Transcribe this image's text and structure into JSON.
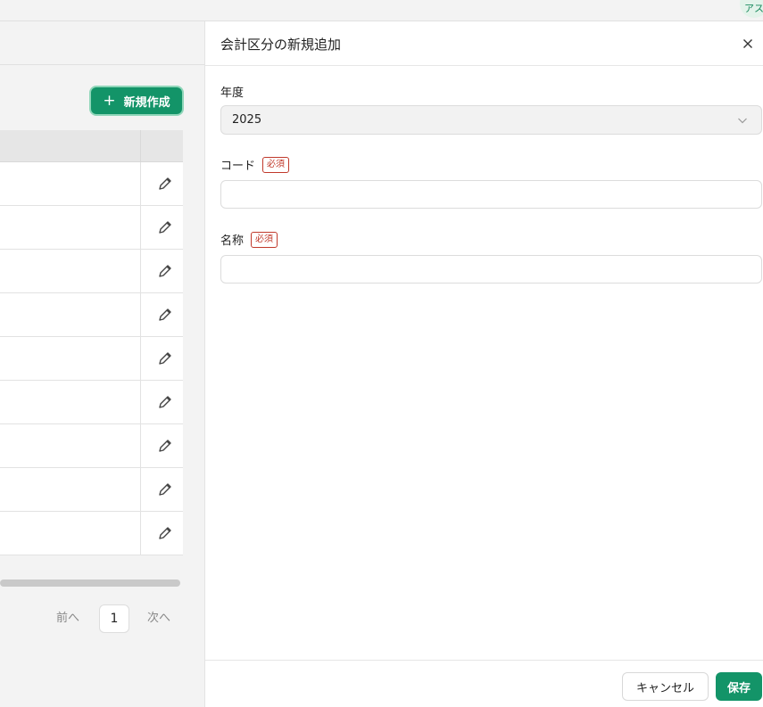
{
  "topbar": {
    "avatar_text": "アス"
  },
  "list": {
    "create_label": "新規作成",
    "rows": 9,
    "pager": {
      "prev_label": "前へ",
      "page": "1",
      "next_label": "次へ"
    }
  },
  "drawer": {
    "title": "会計区分の新規追加",
    "fields": {
      "year": {
        "label": "年度",
        "value": "2025"
      },
      "code": {
        "label": "コード",
        "required_label": "必須",
        "value": "",
        "placeholder": ""
      },
      "name": {
        "label": "名称",
        "required_label": "必須",
        "value": "",
        "placeholder": ""
      }
    },
    "cancel_label": "キャンセル",
    "save_label": "保存"
  },
  "colors": {
    "primary": "#139468",
    "required": "#c0392b"
  },
  "icons": {
    "plus": "plus-icon",
    "edit": "pencil-icon",
    "close": "close-icon",
    "select": "chevron-down-icon"
  }
}
